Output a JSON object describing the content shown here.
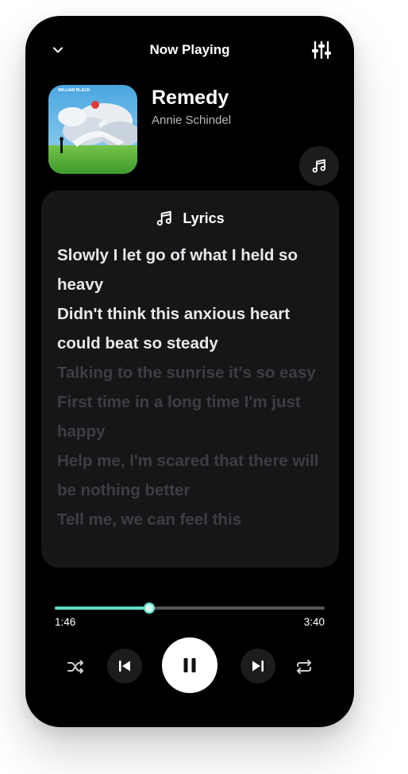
{
  "header": {
    "title": "Now Playing"
  },
  "track": {
    "title": "Remedy",
    "artist": "Annie Schindel",
    "album_art_text": "WILLIAM BLACK"
  },
  "lyrics": {
    "label": "Lyrics",
    "active_lines": [
      "Slowly I let go of what I held so heavy",
      "Didn't think this anxious heart could beat so steady"
    ],
    "upcoming_lines": [
      "Talking to the sunrise it's so easy",
      "First time in a long time I'm just happy",
      "Help me, I'm scared that there will be nothing better",
      "Tell me, we can feel this"
    ]
  },
  "playback": {
    "elapsed": "1:46",
    "duration": "3:40",
    "progress_fraction": 0.35
  },
  "colors": {
    "background": "#000000",
    "card": "#161618",
    "accent": "#5ee0c8",
    "lyric_active": "#e9e9ec",
    "lyric_dim": "#3e3e42"
  },
  "icons": {
    "collapse": "chevron-down-icon",
    "equalizer": "equalizer-icon",
    "note": "music-note-icon",
    "shuffle": "shuffle-icon",
    "previous": "skip-previous-icon",
    "play_pause": "pause-icon",
    "next": "skip-next-icon",
    "repeat": "repeat-icon"
  }
}
